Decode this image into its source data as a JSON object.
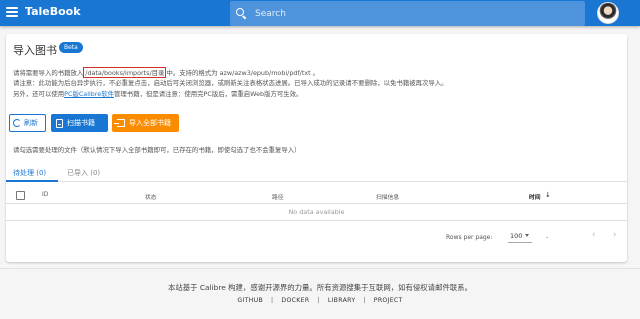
{
  "header": {
    "title": "TaleBook",
    "search_placeholder": "Search"
  },
  "page": {
    "title": "导入图书",
    "badge": "Beta",
    "desc_line1_pre": "请将需要导入的书籍放入",
    "desc_path": "/data/books/imports/目录",
    "desc_line1_post": "中。支持的格式为 azw/azw3/epub/mobi/pdf/txt 。",
    "desc_line2": "请注意：此功能为后台异步执行，不必重复点击，启动后可关闭浏览器，或刷新关注表格状态进展。已导入成功的记录请不要删除，以免书籍被再次导入。",
    "desc_line3_pre": "另外，还可以使用",
    "desc_line3_link": "PC版Calibre软件",
    "desc_line3_post": "管理书籍，但是请注意：使用完PC版后，需重启Web版方可生效。"
  },
  "buttons": {
    "refresh": "刷新",
    "scan": "扫描书籍",
    "import_all": "导入全部书籍"
  },
  "hint": "请勾选需要处理的文件（默认情况下导入全部书籍即可，已存在的书籍，即使勾选了也不会重复导入）",
  "tabs": [
    {
      "label": "待处理 (0)"
    },
    {
      "label": "已导入 (0)"
    }
  ],
  "table": {
    "columns": [
      "ID",
      "状态",
      "路径",
      "扫描信息",
      "时间"
    ],
    "empty_text": "No data available"
  },
  "pagination": {
    "rows_per_page_label": "Rows per page:",
    "rows_per_page_value": "100",
    "range": "-"
  },
  "footer": {
    "text": "本站基于 Calibre 构建，感谢开源界的力量。所有资源搜集于互联网，如有侵权请邮件联系。",
    "links": [
      "GITHUB",
      "DOCKER",
      "LIBRARY",
      "PROJECT"
    ]
  },
  "colors": {
    "primary": "#1976d2",
    "accent_orange": "#fb8c00",
    "highlight_red": "#d32f2f"
  },
  "icons": {
    "menu": "menu-icon",
    "search": "search-icon",
    "refresh": "refresh-icon",
    "scan": "document-icon",
    "import": "import-icon",
    "sort": "arrow-down-icon",
    "prev": "chevron-left-icon",
    "next": "chevron-right-icon"
  }
}
